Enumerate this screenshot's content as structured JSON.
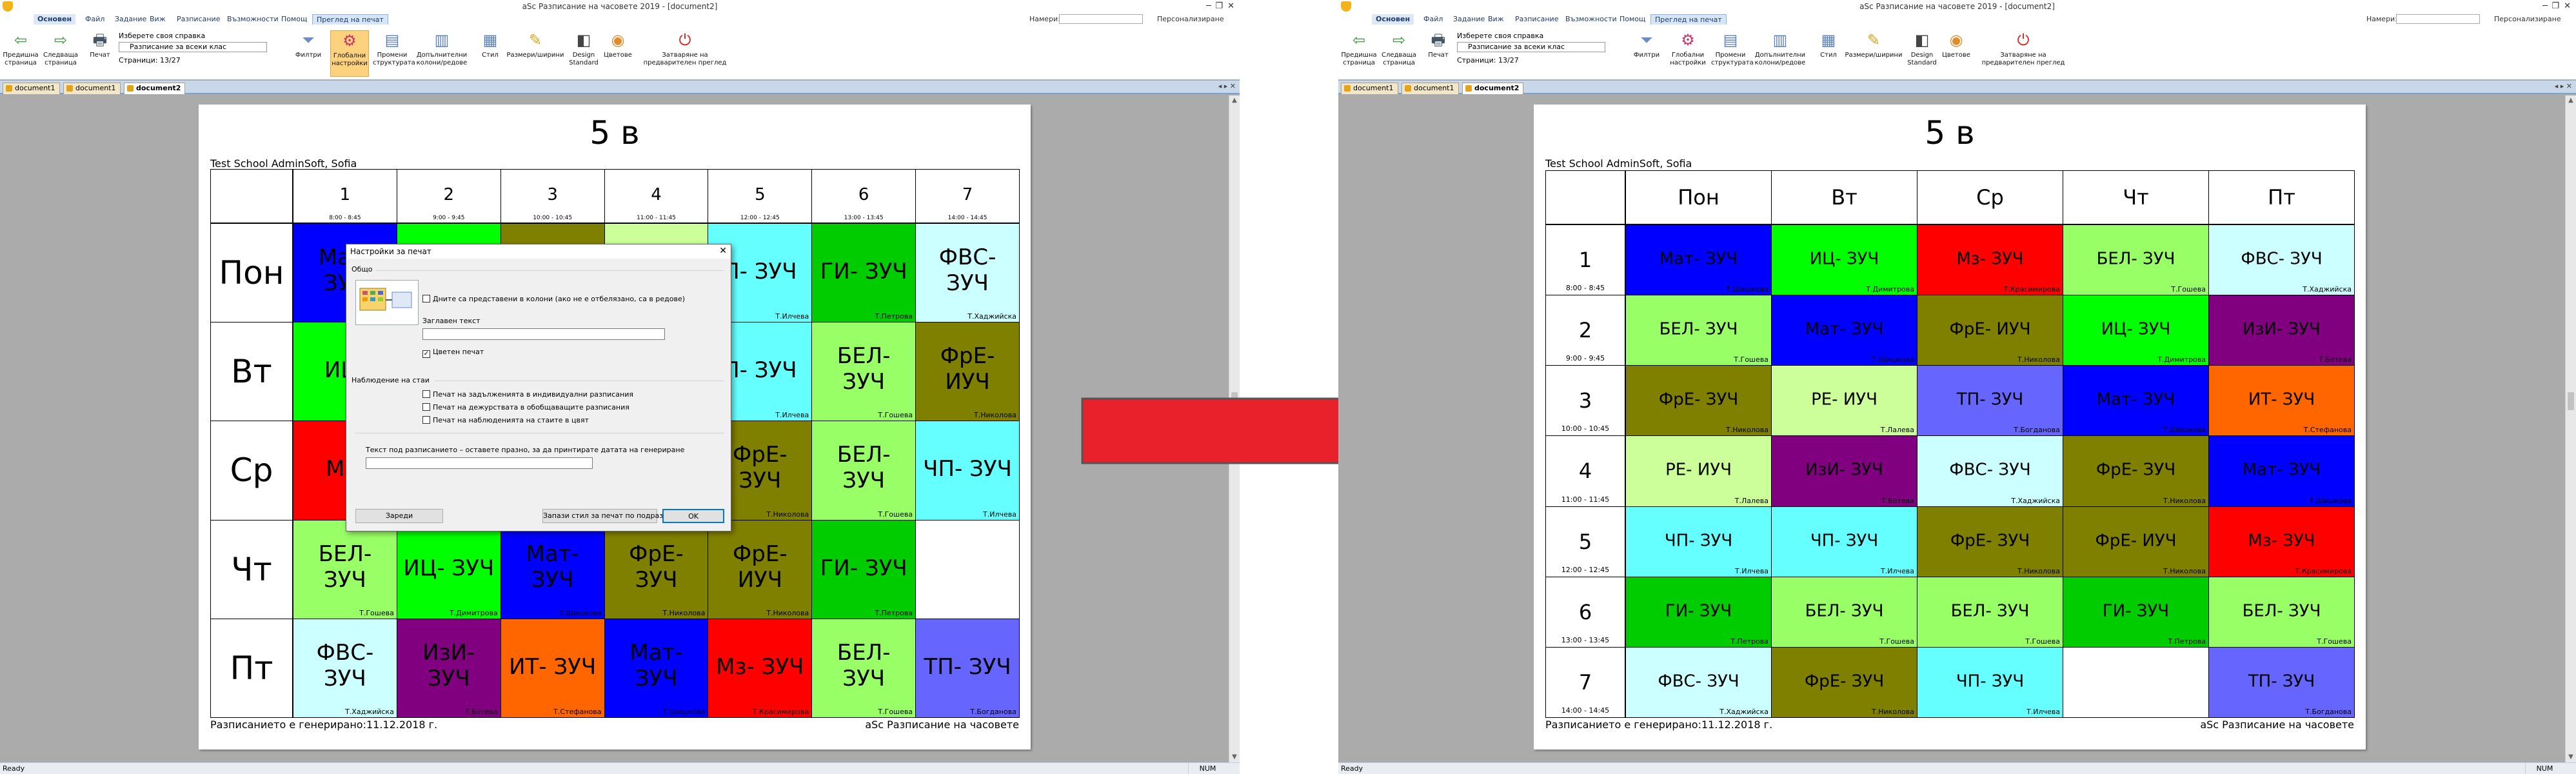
{
  "app": {
    "title": "aSc Разписание на часовете 2019 - [document2]",
    "menu": [
      "Основен",
      "Файл",
      "Задание",
      "Виж",
      "Разписание",
      "Възможности",
      "Помощ",
      "Преглед на печат"
    ],
    "search_label": "Намери:",
    "personalize": "Персонализиране",
    "tabs": [
      "document1",
      "document1",
      "document2"
    ],
    "status": "Ready",
    "num": "NUM"
  },
  "ribbon": {
    "prev_page": "Предишна страница",
    "next_page": "Следваща страница",
    "print": "Печат",
    "choose_report": "Изберете своя справка",
    "report_value": "Разписание за всеки клас",
    "pages": "Страници: 13/27",
    "filters": "Филтри",
    "global_settings": "Глобални настройки",
    "change_structure": "Промени структурата",
    "extra_cols": "Допълнителни колони/редове",
    "style": "Стил",
    "sizes": "Размери/ширини",
    "design": "Design Standard",
    "colors": "Цветове",
    "close_preview": "Затваряне на предварителен преглед"
  },
  "left_doc": {
    "title": "5 в",
    "school": "Test School AdminSoft, Sofia",
    "footer_left": "Разписанието е генерирано:11.12.2018 г.",
    "footer_right": "aSc Разписание на часовете",
    "periods": [
      {
        "n": "1",
        "t": "8:00 - 8:45"
      },
      {
        "n": "2",
        "t": "9:00 - 9:45"
      },
      {
        "n": "3",
        "t": "10:00 - 10:45"
      },
      {
        "n": "4",
        "t": "11:00 - 11:45"
      },
      {
        "n": "5",
        "t": "12:00 - 12:45"
      },
      {
        "n": "6",
        "t": "13:00 - 13:45"
      },
      {
        "n": "7",
        "t": "14:00 - 14:45"
      }
    ],
    "days": [
      {
        "name": "Пон",
        "cells": [
          {
            "s": "Мат- ЗУЧ",
            "t": "",
            "c": "#0000ff"
          },
          {
            "s": "",
            "t": "",
            "c": "#00ff00"
          },
          {
            "s": "",
            "t": "",
            "c": "#808000"
          },
          {
            "s": "",
            "t": "",
            "c": "#ccff99"
          },
          {
            "s": "П- ЗУЧ",
            "t": "Т.Илчева",
            "c": "#66ffff"
          },
          {
            "s": "ГИ- ЗУЧ",
            "t": "Т.Петрова",
            "c": "#00cc00"
          },
          {
            "s": "ФВС- ЗУЧ",
            "t": "Т.Хаджийска",
            "c": "#ccffff"
          }
        ]
      },
      {
        "name": "Вт",
        "cells": [
          {
            "s": "ИЦ-",
            "t": "",
            "c": "#00ff00"
          },
          {
            "s": "",
            "t": "",
            "c": "#800080"
          },
          {
            "s": "",
            "t": "",
            "c": "#ff6600"
          },
          {
            "s": "",
            "t": "",
            "c": "#0000ff"
          },
          {
            "s": "П- ЗУЧ",
            "t": "Т.Илчева",
            "c": "#66ffff"
          },
          {
            "s": "БЕЛ- ЗУЧ",
            "t": "Т.Гошева",
            "c": "#99ff66"
          },
          {
            "s": "ФрЕ- ИУЧ",
            "t": "Т.Николова",
            "c": "#808000"
          }
        ]
      },
      {
        "name": "Ср",
        "cells": [
          {
            "s": "Мз-",
            "t": "",
            "c": "#ff0000"
          },
          {
            "s": "",
            "t": "",
            "c": "#ccffff"
          },
          {
            "s": "",
            "t": "",
            "c": "#808000"
          },
          {
            "s": "",
            "t": "",
            "c": "#ccff99"
          },
          {
            "s": "ФрЕ- ЗУЧ",
            "t": "Т.Николова",
            "c": "#808000"
          },
          {
            "s": "БЕЛ- ЗУЧ",
            "t": "Т.Гошева",
            "c": "#99ff66"
          },
          {
            "s": "ЧП- ЗУЧ",
            "t": "Т.Илчева",
            "c": "#66ffff"
          }
        ]
      },
      {
        "name": "Чт",
        "cells": [
          {
            "s": "БЕЛ- ЗУЧ",
            "t": "Т.Гошева",
            "c": "#99ff66"
          },
          {
            "s": "ИЦ- ЗУЧ",
            "t": "Т.Димитрова",
            "c": "#00ff00"
          },
          {
            "s": "Мат- ЗУЧ",
            "t": "Т.Шишкова",
            "c": "#0000ff"
          },
          {
            "s": "ФрЕ- ЗУЧ",
            "t": "Т.Николова",
            "c": "#808000"
          },
          {
            "s": "ФрЕ- ИУЧ",
            "t": "Т.Николова",
            "c": "#808000"
          },
          {
            "s": "ГИ- ЗУЧ",
            "t": "Т.Петрова",
            "c": "#00cc00"
          },
          {
            "s": "",
            "t": "",
            "c": "#ffffff"
          }
        ]
      },
      {
        "name": "Пт",
        "cells": [
          {
            "s": "ФВС- ЗУЧ",
            "t": "Т.Хаджийска",
            "c": "#ccffff"
          },
          {
            "s": "ИзИ- ЗУЧ",
            "t": "Т.Ботева",
            "c": "#800080"
          },
          {
            "s": "ИТ- ЗУЧ",
            "t": "Т.Стефанова",
            "c": "#ff6600"
          },
          {
            "s": "Мат- ЗУЧ",
            "t": "Т.Шишкова",
            "c": "#0000ff"
          },
          {
            "s": "Мз- ЗУЧ",
            "t": "Т.Красимирова",
            "c": "#ff0000"
          },
          {
            "s": "БЕЛ- ЗУЧ",
            "t": "Т.Гошева",
            "c": "#99ff66"
          },
          {
            "s": "ТП- ЗУЧ",
            "t": "Т.Богданова",
            "c": "#6666ff"
          }
        ]
      }
    ]
  },
  "dialog": {
    "title": "Настройки за печат",
    "general": "Общо",
    "chk_days_cols": "Дните са представени в колони (ако не е отбелязано, са в редове)",
    "header_text_label": "Заглавен текст",
    "chk_color_print": "Цветен печат",
    "watch_group": "Наблюдение на стаи",
    "chk_w1": "Печат на задълженията в индивидуални разписания",
    "chk_w2": "Печат на дежурствата в обобщаващите разписания",
    "chk_w3": "Печат на наблюденията на стаите в цвят",
    "footer_text_label": "Текст под разписанието – оставете празно, за да принтирате датата на генериране",
    "load_btn": "Зареди",
    "save_default_btn": "Запази стил за печат по подразбиране",
    "ok_btn": "OK"
  },
  "right_doc": {
    "title": "5 в",
    "school": "Test School AdminSoft, Sofia",
    "footer_left": "Разписанието е генерирано:11.12.2018 г.",
    "footer_right": "aSc Разписание на часовете",
    "days": [
      "Пон",
      "Вт",
      "Ср",
      "Чт",
      "Пт"
    ],
    "periods": [
      {
        "n": "1",
        "t": "8:00 - 8:45",
        "cells": [
          {
            "s": "Мат- ЗУЧ",
            "t": "Т.Шишкова",
            "c": "#0000ff"
          },
          {
            "s": "ИЦ- ЗУЧ",
            "t": "Т.Димитрова",
            "c": "#00ff00"
          },
          {
            "s": "Мз- ЗУЧ",
            "t": "Т.Красимирова",
            "c": "#ff0000"
          },
          {
            "s": "БЕЛ- ЗУЧ",
            "t": "Т.Гошева",
            "c": "#99ff66"
          },
          {
            "s": "ФВС- ЗУЧ",
            "t": "Т.Хаджийска",
            "c": "#ccffff"
          }
        ]
      },
      {
        "n": "2",
        "t": "9:00 - 9:45",
        "cells": [
          {
            "s": "БЕЛ- ЗУЧ",
            "t": "Т.Гошева",
            "c": "#99ff66"
          },
          {
            "s": "Мат- ЗУЧ",
            "t": "Т.Шишкова",
            "c": "#0000ff"
          },
          {
            "s": "ФрЕ- ИУЧ",
            "t": "Т.Николова",
            "c": "#808000"
          },
          {
            "s": "ИЦ- ЗУЧ",
            "t": "Т.Димитрова",
            "c": "#00ff00"
          },
          {
            "s": "ИзИ- ЗУЧ",
            "t": "Т.Ботева",
            "c": "#800080"
          }
        ]
      },
      {
        "n": "3",
        "t": "10:00 - 10:45",
        "cells": [
          {
            "s": "ФрЕ- ЗУЧ",
            "t": "Т.Николова",
            "c": "#808000"
          },
          {
            "s": "РЕ- ИУЧ",
            "t": "Т.Лалева",
            "c": "#ccff99"
          },
          {
            "s": "ТП- ЗУЧ",
            "t": "Т.Богданова",
            "c": "#6666ff"
          },
          {
            "s": "Мат- ЗУЧ",
            "t": "Т.Шишкова",
            "c": "#0000ff"
          },
          {
            "s": "ИТ- ЗУЧ",
            "t": "Т.Стефанова",
            "c": "#ff6600"
          }
        ]
      },
      {
        "n": "4",
        "t": "11:00 - 11:45",
        "cells": [
          {
            "s": "РЕ- ИУЧ",
            "t": "Т.Лалева",
            "c": "#ccff99"
          },
          {
            "s": "ИзИ- ЗУЧ",
            "t": "Т.Ботева",
            "c": "#800080"
          },
          {
            "s": "ФВС- ЗУЧ",
            "t": "Т.Хаджийска",
            "c": "#ccffff"
          },
          {
            "s": "ФрЕ- ЗУЧ",
            "t": "Т.Николова",
            "c": "#808000"
          },
          {
            "s": "Мат- ЗУЧ",
            "t": "Т.Шишкова",
            "c": "#0000ff"
          }
        ]
      },
      {
        "n": "5",
        "t": "12:00 - 12:45",
        "cells": [
          {
            "s": "ЧП- ЗУЧ",
            "t": "Т.Илчева",
            "c": "#66ffff"
          },
          {
            "s": "ЧП- ЗУЧ",
            "t": "Т.Илчева",
            "c": "#66ffff"
          },
          {
            "s": "ФрЕ- ЗУЧ",
            "t": "Т.Николова",
            "c": "#808000"
          },
          {
            "s": "ФрЕ- ИУЧ",
            "t": "Т.Николова",
            "c": "#808000"
          },
          {
            "s": "Мз- ЗУЧ",
            "t": "Т.Красимирова",
            "c": "#ff0000"
          }
        ]
      },
      {
        "n": "6",
        "t": "13:00 - 13:45",
        "cells": [
          {
            "s": "ГИ- ЗУЧ",
            "t": "Т.Петрова",
            "c": "#00cc00"
          },
          {
            "s": "БЕЛ- ЗУЧ",
            "t": "Т.Гошева",
            "c": "#99ff66"
          },
          {
            "s": "БЕЛ- ЗУЧ",
            "t": "Т.Гошева",
            "c": "#99ff66"
          },
          {
            "s": "ГИ- ЗУЧ",
            "t": "Т.Петрова",
            "c": "#00cc00"
          },
          {
            "s": "БЕЛ- ЗУЧ",
            "t": "Т.Гошева",
            "c": "#99ff66"
          }
        ]
      },
      {
        "n": "7",
        "t": "14:00 - 14:45",
        "cells": [
          {
            "s": "ФВС- ЗУЧ",
            "t": "Т.Хаджийска",
            "c": "#ccffff"
          },
          {
            "s": "ФрЕ- ЗУЧ",
            "t": "Т.Николова",
            "c": "#808000"
          },
          {
            "s": "ЧП- ЗУЧ",
            "t": "Т.Илчева",
            "c": "#66ffff"
          },
          {
            "s": "",
            "t": "",
            "c": "#ffffff"
          },
          {
            "s": "ТП- ЗУЧ",
            "t": "Т.Богданова",
            "c": "#6666ff"
          }
        ]
      }
    ]
  },
  "arrow_color": "#e8212b"
}
